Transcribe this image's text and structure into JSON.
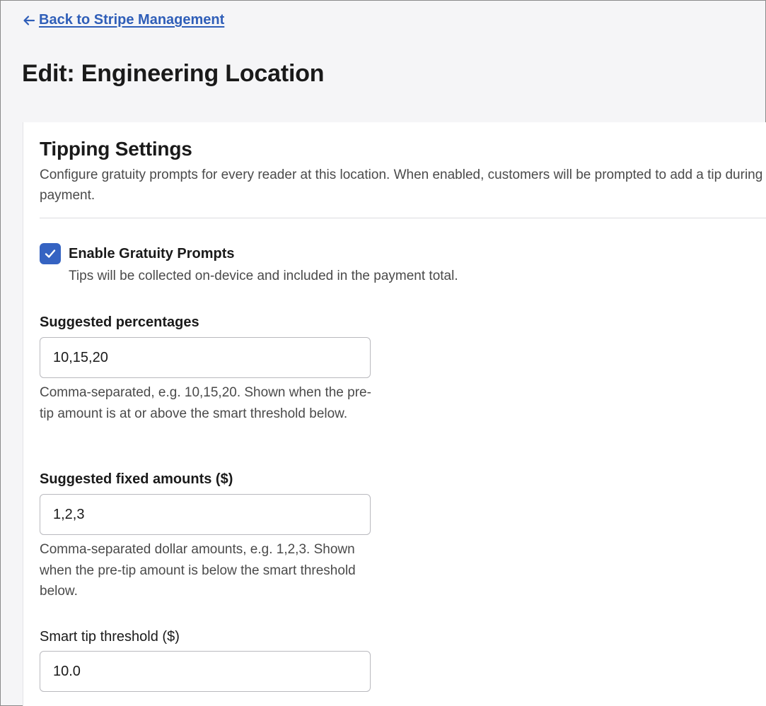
{
  "nav": {
    "back_label": "Back to Stripe Management"
  },
  "page": {
    "title": "Edit: Engineering Location"
  },
  "tipping": {
    "title": "Tipping Settings",
    "description": "Configure gratuity prompts for every reader at this location. When enabled, customers will be prompted to add a tip during payment.",
    "enable": {
      "label": "Enable Gratuity Prompts",
      "hint": "Tips will be collected on-device and included in the payment total.",
      "checked": true
    },
    "percentages": {
      "label": "Suggested percentages",
      "value": "10,15,20",
      "help": "Comma-separated, e.g. 10,15,20. Shown when the pre-tip amount is at or above the smart threshold below."
    },
    "fixed_amounts": {
      "label": "Suggested fixed amounts ($)",
      "value": "1,2,3",
      "help": "Comma-separated dollar amounts, e.g. 1,2,3. Shown when the pre-tip amount is below the smart threshold below."
    },
    "threshold": {
      "label": "Smart tip threshold ($)",
      "value": "10.0"
    }
  },
  "colors": {
    "accent": "#3563c2",
    "link": "#2f5eb8",
    "background": "#f5f5f7"
  }
}
